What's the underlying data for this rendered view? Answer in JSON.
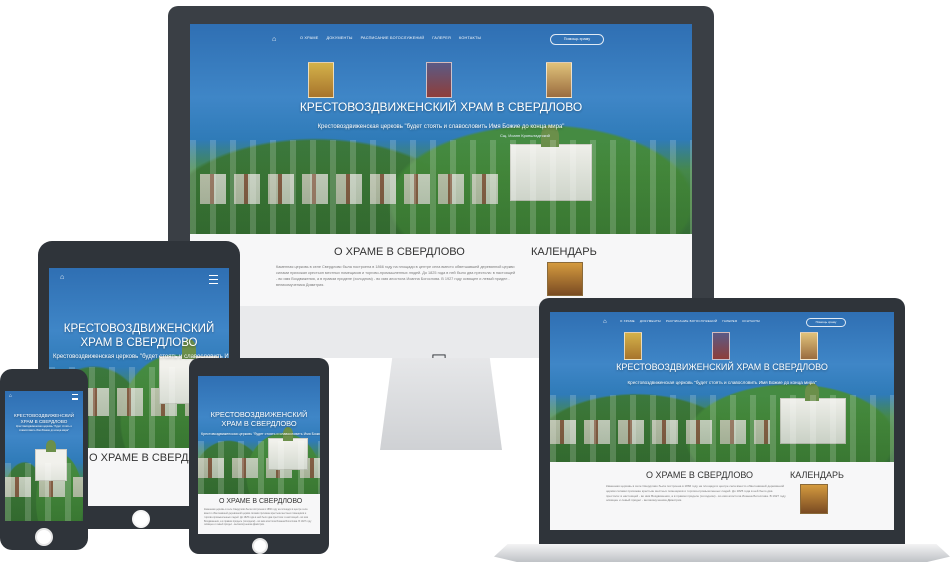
{
  "site": {
    "nav": {
      "items": [
        "О храме",
        "Документы",
        "Расписание богослужений",
        "Галерея",
        "Контакты"
      ],
      "help": "Помощь храму"
    },
    "title": "КРЕСТОВОЗДВИЖЕНСКИЙ ХРАМ В СВЕРДЛОВО",
    "title_tablet": "КРЕСТОВОЗДВИЖЕНСКИЙ ХРАМ В СВЕРДЛОВО",
    "quote": "Крестовоздвиженская церковь \"будет стоять и славословить Имя Божие до конца мира\"",
    "quote_cut": "Крестовоздвиженская церковь \"будет стоять и славословить Имя Божие до конца мира\"",
    "quote_sign": "Сщ. Иоанн Кронштадтский",
    "about_title": "О ХРАМЕ В СВЕРДЛОВО",
    "calendar_title": "КАЛЕНДАРЬ",
    "about_text": "Каменная церковь в селе Свердлово была построена в 1866 году на площади в центре села вместо обветшавшей деревянной церкви силами прихожан крестьян местных помещиков и торгово-промышленных людей. До 1825 года в ней было два престола: в настоящей - во имя Воздвижения, а в правом приделе (холодном) - во имя апостола Иоанна Богослова. В 1927 году освящен и левый придел - великомученика Димитрия."
  },
  "colors": {
    "bezel": "#2f343a",
    "content_bg": "#f7f7f8",
    "hero_blue": "#2f6fb3"
  }
}
